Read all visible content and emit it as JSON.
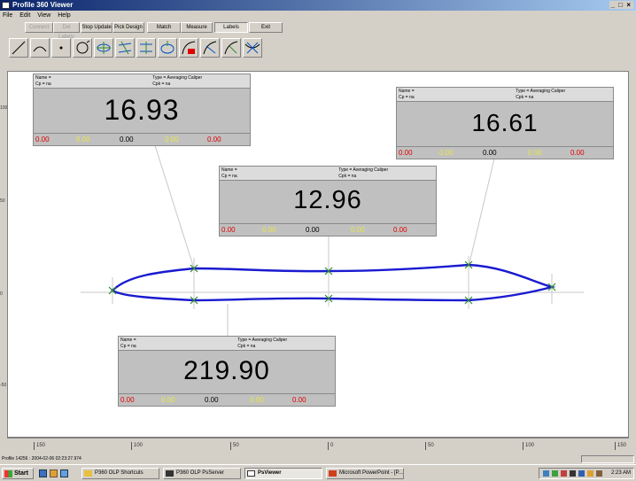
{
  "window": {
    "title": "Profile 360 Viewer",
    "controls": "_ □ ×"
  },
  "menu": [
    "File",
    "Edit",
    "View",
    "Help"
  ],
  "buttons": {
    "b0": "Connect",
    "b1": "Del Labels",
    "b2": "Stop Update",
    "b3": "Pick Design",
    "b4": "Match",
    "b5": "Measure",
    "b6": "Labels",
    "b7": "Exit"
  },
  "tools": [
    "line-tool-icon",
    "arc-tool-icon",
    "point-tool-icon",
    "circle-tool-icon",
    "hole-tool-icon",
    "parallel-tool-icon",
    "distance-tool-icon",
    "ellipse-tool-icon",
    "offset-arc-tool-icon",
    "angle-tool-icon",
    "radius-tool-icon",
    "caliper-tool-icon"
  ],
  "labels": {
    "m1": {
      "name": "Name =",
      "cp": "Cp = na",
      "type": "Type = Averaging Caliper",
      "cpk": "Cpk = na",
      "value": "16.93",
      "stats": [
        "0.00",
        "0.00",
        "0.00",
        "0.00",
        "0.00"
      ]
    },
    "m2": {
      "name": "Name =",
      "cp": "Cp = na",
      "type": "Type = Averaging Caliper",
      "cpk": "Cpk = na",
      "value": "16.61",
      "stats": [
        "0.00",
        "0.00",
        "0.00",
        "0.00",
        "0.00"
      ]
    },
    "m3": {
      "name": "Name =",
      "cp": "Cp = na",
      "type": "Type = Averaging Caliper",
      "cpk": "Cpk = na",
      "value": "12.96",
      "stats": [
        "0.00",
        "0.00",
        "0.00",
        "0.00",
        "0.00"
      ]
    },
    "m4": {
      "name": "Name =",
      "cp": "Cp = na",
      "type": "Type = Averaging Caliper",
      "cpk": "Cpk = na",
      "value": "219.90",
      "stats": [
        "0.00",
        "0.00",
        "0.00",
        "0.00",
        "0.00"
      ]
    }
  },
  "y_ruler": [
    "100",
    "50",
    "0",
    "-50"
  ],
  "x_ruler": [
    "150",
    "100",
    "50",
    "0",
    "50",
    "100",
    "150"
  ],
  "status": {
    "text": "Profile 14256 : 2004-02-06 02:23:27.974"
  },
  "taskbar": {
    "start": "Start",
    "items": [
      "P360 OLP Shortcuts",
      "P360 OLP PsServer",
      "PsViewer",
      "Microsoft PowerPoint - [P..."
    ],
    "clock": "2:23 AM"
  },
  "colors": {
    "profile": "#1a1ad0",
    "stat_red": "#e00000",
    "stat_yellow": "#e6e64a",
    "marker": "#2e8b2e"
  }
}
